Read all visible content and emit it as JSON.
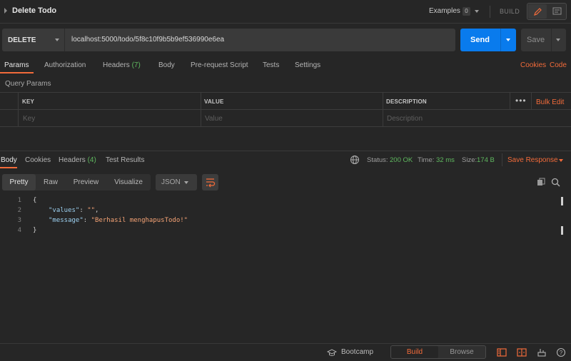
{
  "header": {
    "title": "Delete Todo",
    "examples_label": "Examples",
    "examples_count": "0",
    "build_label": "BUILD"
  },
  "request": {
    "method": "DELETE",
    "url": "localhost:5000/todo/5f8c10f9b5b9ef536990e6ea",
    "send_label": "Send",
    "save_label": "Save"
  },
  "request_tabs": {
    "params": "Params",
    "authorization": "Authorization",
    "headers": "Headers",
    "headers_count": "(7)",
    "body": "Body",
    "prerequest": "Pre-request Script",
    "tests": "Tests",
    "settings": "Settings",
    "cookies": "Cookies",
    "code": "Code"
  },
  "query_params": {
    "title": "Query Params",
    "col_key": "KEY",
    "col_value": "VALUE",
    "col_description": "DESCRIPTION",
    "bulk_edit": "Bulk Edit",
    "placeholder_key": "Key",
    "placeholder_value": "Value",
    "placeholder_description": "Description"
  },
  "response_tabs": {
    "body": "Body",
    "cookies": "Cookies",
    "headers": "Headers",
    "headers_count": "(4)",
    "test_results": "Test Results"
  },
  "response_status": {
    "status_label": "Status:",
    "status_value": "200 OK",
    "time_label": "Time:",
    "time_value": "32 ms",
    "size_label": "Size:",
    "size_value": "174 B",
    "save_response": "Save Response"
  },
  "view": {
    "pretty": "Pretty",
    "raw": "Raw",
    "preview": "Preview",
    "visualize": "Visualize",
    "format": "JSON"
  },
  "code_lines": [
    {
      "n": "1",
      "text": "{"
    },
    {
      "n": "2",
      "key": "\"values\"",
      "sep": ": ",
      "val": "\"\"",
      "end": ","
    },
    {
      "n": "3",
      "key": "\"message\"",
      "sep": ": ",
      "val": "\"Berhasil menghapusTodo!\"",
      "end": ""
    },
    {
      "n": "4",
      "text": "}"
    }
  ],
  "footer": {
    "bootcamp": "Bootcamp",
    "build": "Build",
    "browse": "Browse"
  },
  "colors": {
    "accent": "#f26b3a",
    "send": "#097bed",
    "success": "#5fb85f"
  }
}
